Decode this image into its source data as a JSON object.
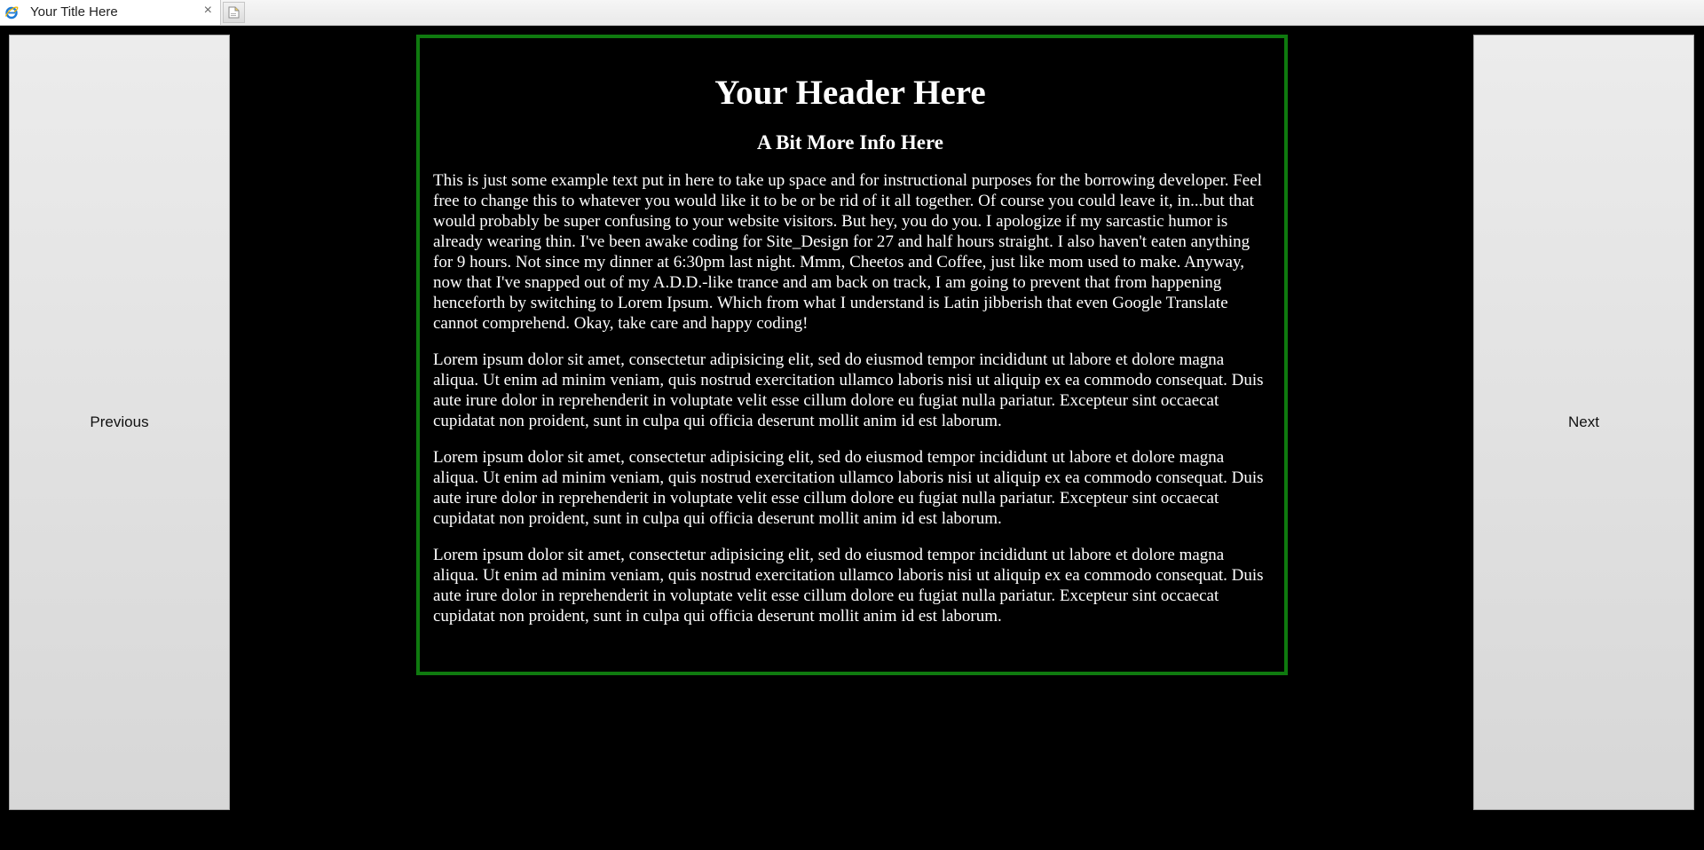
{
  "browser": {
    "tab_title": "Your Title Here",
    "tab_close": "×",
    "favicon": "ie-icon",
    "newtab_icon": "new-tab-icon"
  },
  "nav": {
    "previous_label": "Previous",
    "next_label": "Next"
  },
  "content": {
    "header": "Your Header Here",
    "subheader": "A Bit More Info Here",
    "paragraphs": [
      "This is just some example text put in here to take up space and for instructional purposes for the borrowing developer. Feel free to change this to whatever you would like it to be or be rid of it all together. Of course you could leave it, in...but that would probably be super confusing to your website visitors. But hey, you do you. I apologize if my sarcastic humor is already wearing thin. I've been awake coding for Site_Design for 27 and half hours straight. I also haven't eaten anything for 9 hours. Not since my dinner at 6:30pm last night. Mmm, Cheetos and Coffee, just like mom used to make. Anyway, now that I've snapped out of my A.D.D.-like trance and am back on track, I am going to prevent that from happening henceforth by switching to Lorem Ipsum. Which from what I understand is Latin jibberish that even Google Translate cannot comprehend. Okay, take care and happy coding!",
      "Lorem ipsum dolor sit amet, consectetur adipisicing elit, sed do eiusmod tempor incididunt ut labore et dolore magna aliqua. Ut enim ad minim veniam, quis nostrud exercitation ullamco laboris nisi ut aliquip ex ea commodo consequat. Duis aute irure dolor in reprehenderit in voluptate velit esse cillum dolore eu fugiat nulla pariatur. Excepteur sint occaecat cupidatat non proident, sunt in culpa qui officia deserunt mollit anim id est laborum.",
      "Lorem ipsum dolor sit amet, consectetur adipisicing elit, sed do eiusmod tempor incididunt ut labore et dolore magna aliqua. Ut enim ad minim veniam, quis nostrud exercitation ullamco laboris nisi ut aliquip ex ea commodo consequat. Duis aute irure dolor in reprehenderit in voluptate velit esse cillum dolore eu fugiat nulla pariatur. Excepteur sint occaecat cupidatat non proident, sunt in culpa qui officia deserunt mollit anim id est laborum.",
      "Lorem ipsum dolor sit amet, consectetur adipisicing elit, sed do eiusmod tempor incididunt ut labore et dolore magna aliqua. Ut enim ad minim veniam, quis nostrud exercitation ullamco laboris nisi ut aliquip ex ea commodo consequat. Duis aute irure dolor in reprehenderit in voluptate velit esse cillum dolore eu fugiat nulla pariatur. Excepteur sint occaecat cupidatat non proident, sunt in culpa qui officia deserunt mollit anim id est laborum."
    ]
  },
  "colors": {
    "page_background": "#000000",
    "panel_border": "#0f7a0f",
    "text": "#ffffff",
    "button_face": "#e0e0e0"
  }
}
